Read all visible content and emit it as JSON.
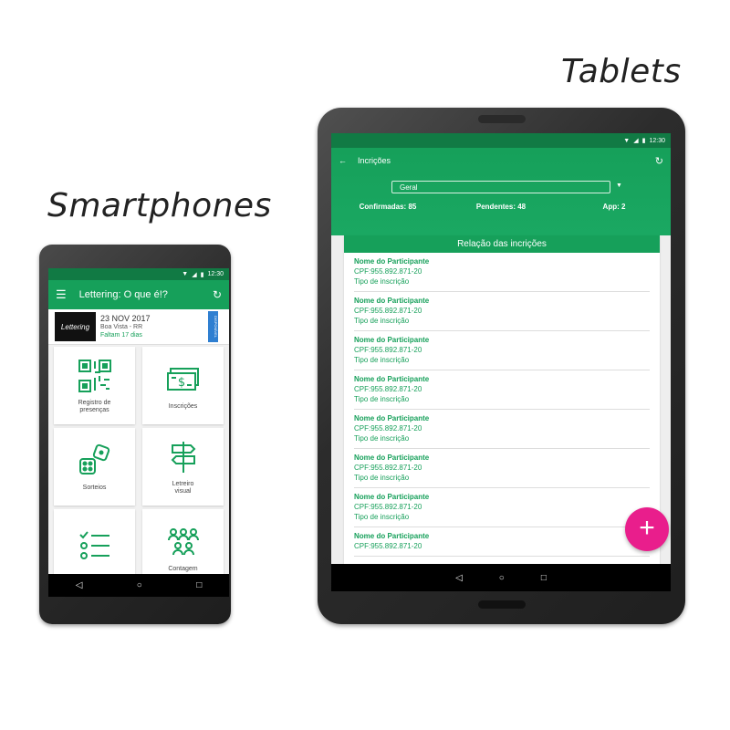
{
  "captions": {
    "smartphones": "Smartphones",
    "tablets": "Tablets"
  },
  "phone": {
    "status_time": "12:30",
    "app_title": "Lettering: O que é!?",
    "event": {
      "thumb_text": "Lettering",
      "date": "23 NOV 2017",
      "location": "Boa Vista - RR",
      "remaining": "Faltam 17 dias",
      "badge": "DISPONÍVEL"
    },
    "tiles": [
      {
        "label": "Registro de\npresenças",
        "icon": "qr-code-icon"
      },
      {
        "label": "Inscrições",
        "icon": "money-icon"
      },
      {
        "label": "Sorteios",
        "icon": "dice-icon"
      },
      {
        "label": "Letreiro\nvisual",
        "icon": "signpost-icon"
      },
      {
        "label": "",
        "icon": "checklist-icon"
      },
      {
        "label": "Contagem",
        "icon": "people-icon"
      }
    ],
    "nav": {
      "back": "◁",
      "home": "○",
      "recent": "□"
    }
  },
  "tablet": {
    "status_time": "12:30",
    "app_title": "Incrições",
    "filter_value": "Geral",
    "counts": {
      "confirmed_label": "Confirmadas:",
      "confirmed": "85",
      "pending_label": "Pendentes:",
      "pending": "48",
      "app_label": "App:",
      "app": "2"
    },
    "list_title": "Relação das incrições",
    "items": [
      {
        "name": "Nome do Participante",
        "cpf": "CPF:955.892.871-20",
        "type": "Tipo de inscrição"
      },
      {
        "name": "Nome do Participante",
        "cpf": "CPF:955.892.871-20",
        "type": "Tipo de inscrição"
      },
      {
        "name": "Nome do Participante",
        "cpf": "CPF:955.892.871-20",
        "type": "Tipo de inscrição"
      },
      {
        "name": "Nome do Participante",
        "cpf": "CPF:955.892.871-20",
        "type": "Tipo de inscrição"
      },
      {
        "name": "Nome do Participante",
        "cpf": "CPF:955.892.871-20",
        "type": "Tipo de inscrição"
      },
      {
        "name": "Nome do Participante",
        "cpf": "CPF:955.892.871-20",
        "type": "Tipo de inscrição"
      },
      {
        "name": "Nome do Participante",
        "cpf": "CPF:955.892.871-20",
        "type": "Tipo de inscrição"
      },
      {
        "name": "Nome do Participante",
        "cpf": "CPF:955.892.871-20",
        "type": ""
      }
    ],
    "fab": "+",
    "nav": {
      "back": "◁",
      "home": "○",
      "recent": "□"
    }
  },
  "colors": {
    "primary": "#16a05a",
    "primary_dark": "#117a44",
    "fab": "#e91e8c",
    "badge": "#2f7fd1"
  }
}
